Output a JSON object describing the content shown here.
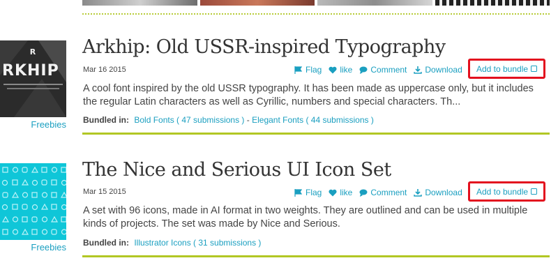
{
  "colors": {
    "accent": "#1a9fc0",
    "highlight_border": "#e3101e",
    "divider": "#b2c724"
  },
  "posts": [
    {
      "title": "Arkhip: Old USSR-inspired Typography",
      "date": "Mar 16 2015",
      "category": "Freebies",
      "thumb_text": "RKHIP",
      "actions": {
        "flag": "Flag",
        "like": "like",
        "comment": "Comment",
        "download": "Download",
        "add_bundle": "Add to bundle"
      },
      "description": "A cool font inspired by the old USSR typography. It has been made as uppercase only, but it includes the regular Latin characters as well as Cyrillic, numbers and special characters. Th...",
      "bundled_label": "Bundled in:",
      "bundles": [
        "Bold Fonts ( 47 submissions )",
        "Elegant Fonts ( 44 submissions )"
      ],
      "bundle_separator": "-"
    },
    {
      "title": "The Nice and Serious UI Icon Set",
      "date": "Mar 15 2015",
      "category": "Freebies",
      "actions": {
        "flag": "Flag",
        "like": "like",
        "comment": "Comment",
        "download": "Download",
        "add_bundle": "Add to bundle"
      },
      "description": "A set with 96 icons, made in AI format in two weights. They are outlined and can be used in multiple kinds of projects. The set was made by Nice and Serious.",
      "bundled_label": "Bundled in:",
      "bundles": [
        "Illustrator Icons ( 31 submissions )"
      ]
    }
  ]
}
